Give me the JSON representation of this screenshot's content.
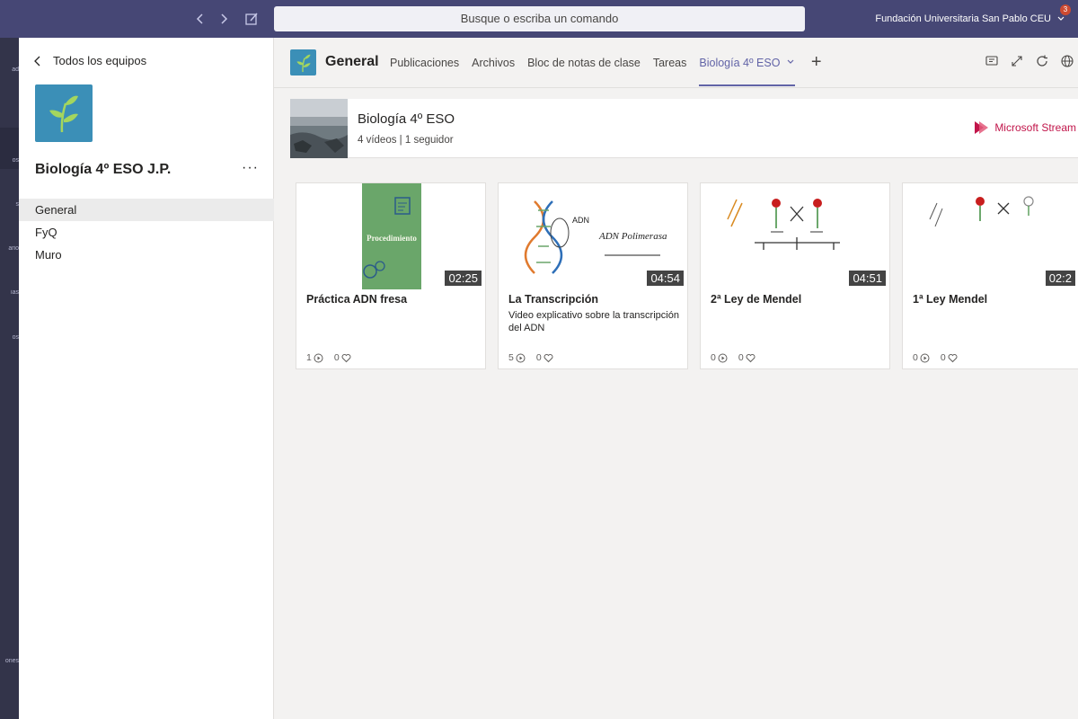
{
  "topbar": {
    "back_icon": "chevron-left-icon",
    "forward_icon": "chevron-right-icon",
    "compose_icon": "compose-icon",
    "search_placeholder": "Busque o escriba un comando",
    "org_name": "Fundación Universitaria San Pablo CEU",
    "org_badge": "3"
  },
  "rail": {
    "labels": [
      "ad",
      "os",
      "s",
      "ario",
      "ias",
      "os",
      "ones"
    ]
  },
  "team": {
    "back_label": "Todos los equipos",
    "name": "Biología 4º ESO J.P.",
    "more": "···",
    "channels": [
      "General",
      "FyQ",
      "Muro"
    ]
  },
  "header": {
    "channel_title": "General",
    "tabs": [
      "Publicaciones",
      "Archivos",
      "Bloc de notas de clase",
      "Tareas",
      "Biología 4º ESO"
    ],
    "active_tab": "Biología 4º ESO",
    "add_tab": "+",
    "icons": [
      "conversation-icon",
      "expand-icon",
      "refresh-icon",
      "globe-icon"
    ]
  },
  "banner": {
    "title": "Biología 4º ESO",
    "subtitle": "4 vídeos | 1 seguidor",
    "brand": "Microsoft Stream"
  },
  "cards": [
    {
      "title": "Práctica ADN fresa",
      "description": "",
      "duration": "02:25",
      "views": "1",
      "likes": "0",
      "thumb_text": "Procedimiento"
    },
    {
      "title": "La Transcripción",
      "description": "Video explicativo sobre la transcripción del ADN",
      "duration": "04:54",
      "views": "5",
      "likes": "0",
      "thumb_text": "ADN",
      "thumb_text2": "ADN Polimerasa"
    },
    {
      "title": "2ª Ley de Mendel",
      "description": "",
      "duration": "04:51",
      "views": "0",
      "likes": "0"
    },
    {
      "title": "1ª Ley Mendel",
      "description": "",
      "duration": "02:2",
      "views": "0",
      "likes": "0"
    }
  ],
  "colors": {
    "topbar": "#464775",
    "rail": "#33344a",
    "accent": "#6264a7",
    "team_logo": "#3b8fb7",
    "stream": "#c1154a"
  }
}
